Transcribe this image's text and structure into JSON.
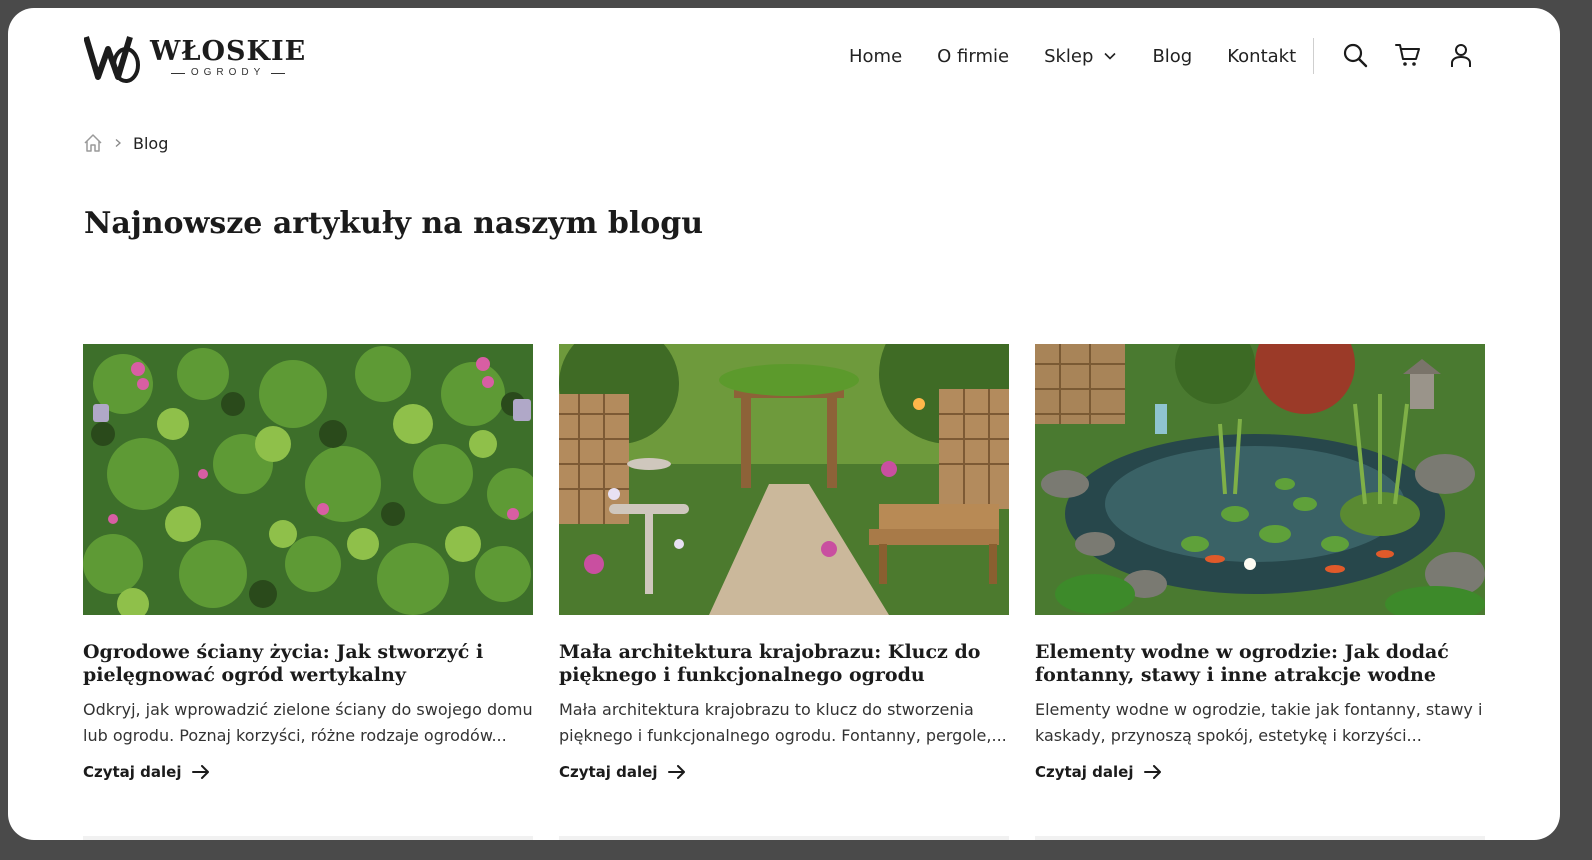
{
  "header": {
    "logo": {
      "name": "WŁOSKIE",
      "sub": "OGRODY"
    },
    "nav": [
      "Home",
      "O firmie",
      "Sklep",
      "Blog",
      "Kontakt"
    ],
    "icons": [
      "search-icon",
      "cart-icon",
      "user-icon"
    ]
  },
  "breadcrumb": {
    "current": "Blog"
  },
  "page": {
    "title": "Najnowsze artykuły na naszym blogu"
  },
  "articles": [
    {
      "title": "Ogrodowe ściany życia: Jak stworzyć i pielęgnować ogród wertykalny",
      "excerpt": "Odkryj, jak wprowadzić zielone ściany do swojego domu lub ogrodu. Poznaj korzyści, różne rodzaje ogrodów...",
      "more": "Czytaj dalej"
    },
    {
      "title": "Mała architektura krajobrazu: Klucz do pięknego i funkcjonalnego ogrodu",
      "excerpt": "Mała architektura krajobrazu to klucz do stworzenia pięknego i funkcjonalnego ogrodu. Fontanny, pergole,...",
      "more": "Czytaj dalej"
    },
    {
      "title": "Elementy wodne w ogrodzie: Jak dodać fontanny, stawy i inne atrakcje wodne",
      "excerpt": "Elementy wodne w ogrodzie, takie jak fontanny, stawy i kaskady, przynoszą spokój, estetykę i korzyści...",
      "more": "Czytaj dalej"
    }
  ]
}
